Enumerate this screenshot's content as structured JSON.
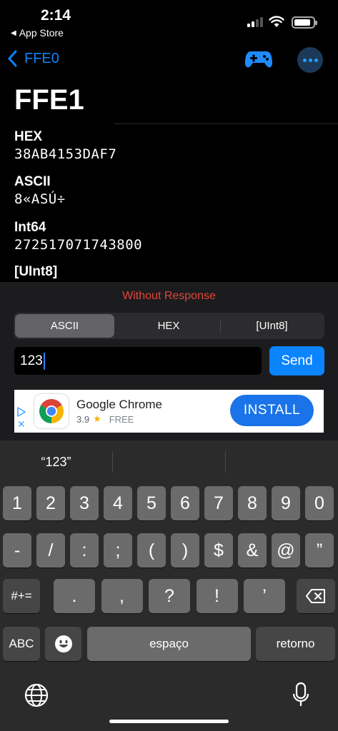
{
  "status_bar": {
    "time": "2:14",
    "back_app": "App Store"
  },
  "nav": {
    "back_label": "FFE0",
    "title": "FFE1"
  },
  "values": [
    {
      "label": "HEX",
      "value": "38AB4153DAF7"
    },
    {
      "label": "ASCII",
      "value": "8«ASÚ÷"
    },
    {
      "label": "Int64",
      "value": "272517071743800"
    },
    {
      "label": "[UInt8]",
      "value": ""
    }
  ],
  "write_panel": {
    "title": "Without Response",
    "segments": [
      "ASCII",
      "HEX",
      "[UInt8]"
    ],
    "selected_segment": "ASCII",
    "input_value": "123",
    "send_label": "Send"
  },
  "ad": {
    "app_name": "Google Chrome",
    "rating": "3.9",
    "price": "FREE",
    "install_label": "INSTALL"
  },
  "keyboard": {
    "suggestion": "“123”",
    "row1": [
      "1",
      "2",
      "3",
      "4",
      "5",
      "6",
      "7",
      "8",
      "9",
      "0"
    ],
    "row2": [
      "-",
      "/",
      ":",
      ";",
      "(",
      ")",
      "$",
      "&",
      "@",
      "”"
    ],
    "row3_left": "#+=",
    "row3": [
      ".",
      ",",
      "?",
      "!",
      "’"
    ],
    "abc_label": "ABC",
    "space_label": "espaço",
    "return_label": "retorno"
  },
  "colors": {
    "accent": "#0a84ff",
    "warning_title": "#e0453a",
    "install": "#1a73e8"
  }
}
